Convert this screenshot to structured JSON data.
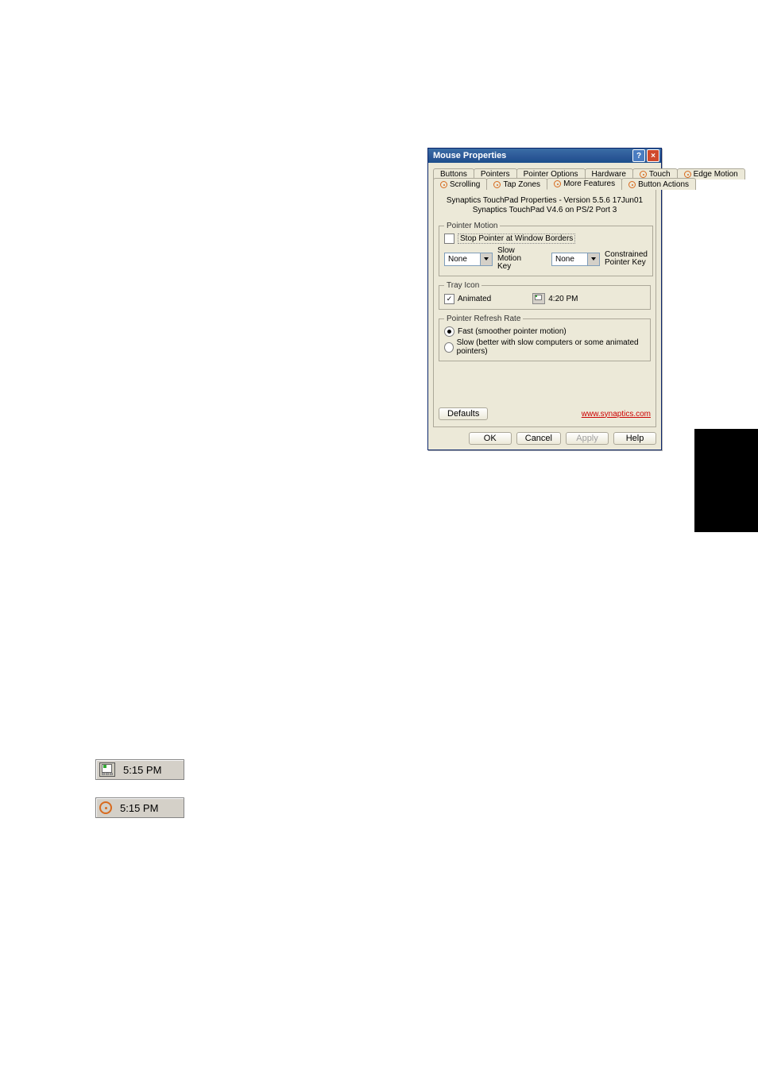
{
  "dialog": {
    "title": "Mouse Properties",
    "tabs_row1": [
      "Buttons",
      "Pointers",
      "Pointer Options",
      "Hardware",
      "Touch",
      "Edge Motion"
    ],
    "tabs_row2": [
      "Scrolling",
      "Tap Zones",
      "More Features",
      "Button Actions"
    ],
    "active_tab": "More Features",
    "info_line1": "Synaptics TouchPad Properties - Version 5.5.6 17Jun01",
    "info_line2": "Synaptics TouchPad V4.6 on PS/2 Port 3",
    "groups": {
      "pointer_motion": {
        "legend": "Pointer Motion",
        "stop_checkbox": {
          "label": "Stop Pointer at Window Borders",
          "checked": false
        },
        "slow_key": {
          "value": "None",
          "label_line1": "Slow",
          "label_line2": "Motion Key"
        },
        "constrained_key": {
          "value": "None",
          "label_line1": "Constrained",
          "label_line2": "Pointer Key"
        }
      },
      "tray_icon": {
        "legend": "Tray Icon",
        "animated_checkbox": {
          "label": "Animated",
          "checked": true
        },
        "time": "4:20 PM"
      },
      "refresh_rate": {
        "legend": "Pointer Refresh Rate",
        "options": {
          "fast": {
            "label": "Fast (smoother pointer motion)",
            "selected": true
          },
          "slow": {
            "label": "Slow (better with slow computers or some animated pointers)",
            "selected": false
          }
        }
      }
    },
    "defaults_button": "Defaults",
    "link_text": "www.synaptics.com",
    "buttons": {
      "ok": "OK",
      "cancel": "Cancel",
      "apply": "Apply",
      "help": "Help"
    }
  },
  "tray_examples": {
    "time": "5:15 PM"
  }
}
